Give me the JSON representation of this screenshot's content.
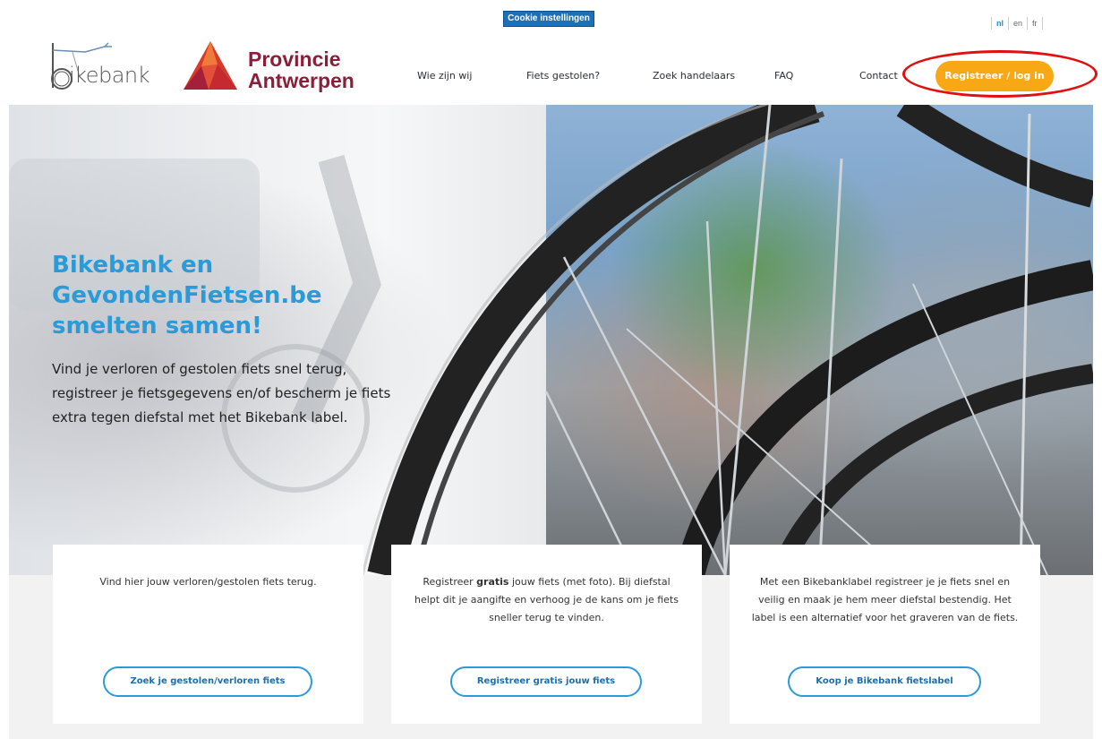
{
  "cookie": {
    "label": "Cookie instellingen"
  },
  "languages": [
    {
      "code": "nl",
      "active": true
    },
    {
      "code": "en",
      "active": false
    },
    {
      "code": "fr",
      "active": false
    }
  ],
  "logos": {
    "bikebank": "ikebank",
    "province_line1": "Provincie",
    "province_line2": "Antwerpen"
  },
  "nav": {
    "items": [
      "Wie zijn wij",
      "Fiets gestolen?",
      "Zoek handelaars",
      "FAQ",
      "Contact"
    ],
    "cta": "Registreer / log in"
  },
  "hero": {
    "title": "Bikebank en GevondenFietsen.be smelten samen!",
    "text": "Vind je verloren of gestolen fiets snel terug, registreer je fietsgegevens en/of bescherm je fiets extra tegen diefstal met het Bikebank label."
  },
  "cards": [
    {
      "text": "Vind hier jouw verloren/gestolen fiets terug.",
      "button": "Zoek je gestolen/verloren fiets"
    },
    {
      "text_before": "Registreer ",
      "text_bold": "gratis",
      "text_after": " jouw fiets (met foto). Bij diefstal helpt dit je aangifte en verhoog je de kans om je fiets sneller terug te vinden.",
      "button": "Registreer gratis jouw fiets"
    },
    {
      "text": "Met een Bikebanklabel registreer je je fiets snel en veilig en maak je hem meer diefstal bestendig. Het label is een alternatief voor het graveren van de fiets.",
      "button": "Koop je Bikebank fietslabel"
    }
  ],
  "colors": {
    "brand_blue": "#2a9ad9",
    "cta_orange": "#f7a814",
    "province_red": "#8b1f3a",
    "annotation_red": "#e01010"
  }
}
